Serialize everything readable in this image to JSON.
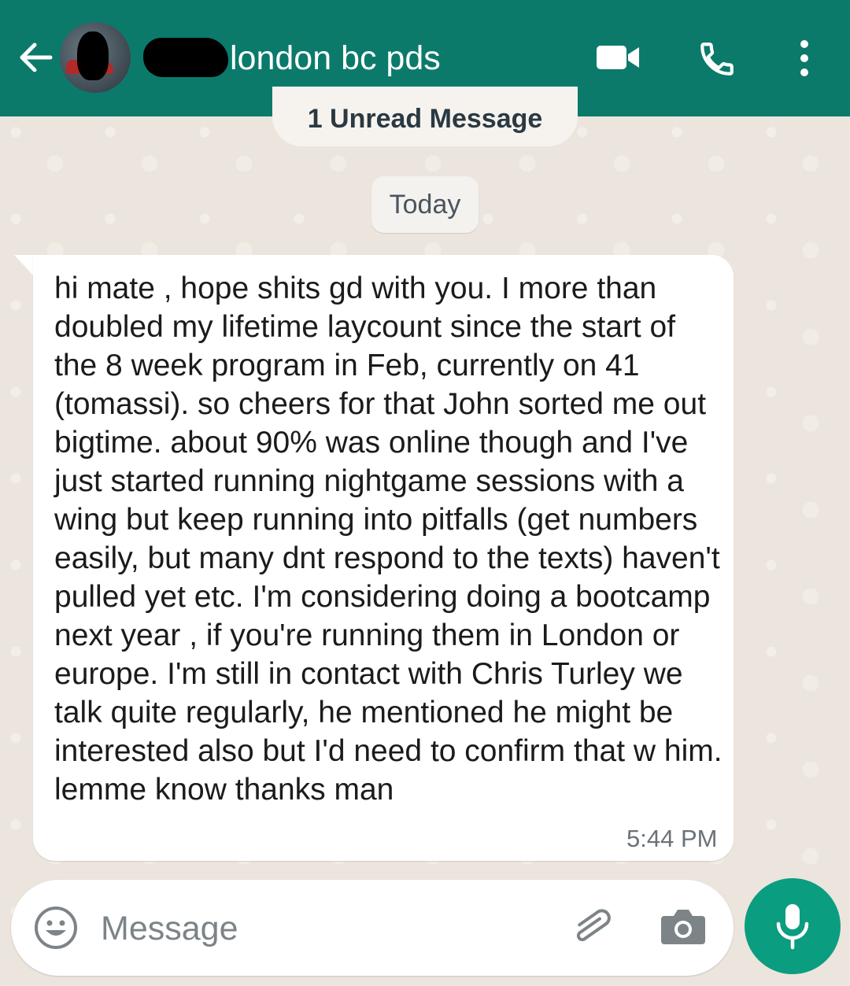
{
  "header": {
    "title": "london bc pds",
    "icons": [
      "back-arrow-icon",
      "video-call-icon",
      "phone-icon",
      "more-vert-icon"
    ],
    "color": "#0b7a6b"
  },
  "chat": {
    "unread_banner": "1 Unread Message",
    "date_label": "Today",
    "messages": [
      {
        "text": "hi mate , hope shits gd with you. I more than doubled my lifetime laycount since the start of the 8 week program in Feb, currently on 41 (tomassi). so cheers for that John sorted me out bigtime. about 90% was online though and I've just started running nightgame sessions with a wing but keep running into pitfalls (get numbers easily, but many dnt respond to the texts) haven't pulled yet etc. I'm considering doing a bootcamp next year , if you're running them in London or europe. I'm still in contact with Chris Turley we talk quite regularly, he mentioned he might be interested also but I'd need to confirm that w him. lemme know thanks man",
        "time": "5:44 PM"
      }
    ]
  },
  "composer": {
    "placeholder": "Message",
    "icons": [
      "emoji-icon",
      "attach-icon",
      "camera-icon",
      "mic-icon"
    ],
    "mic_color": "#0b9d7f"
  }
}
